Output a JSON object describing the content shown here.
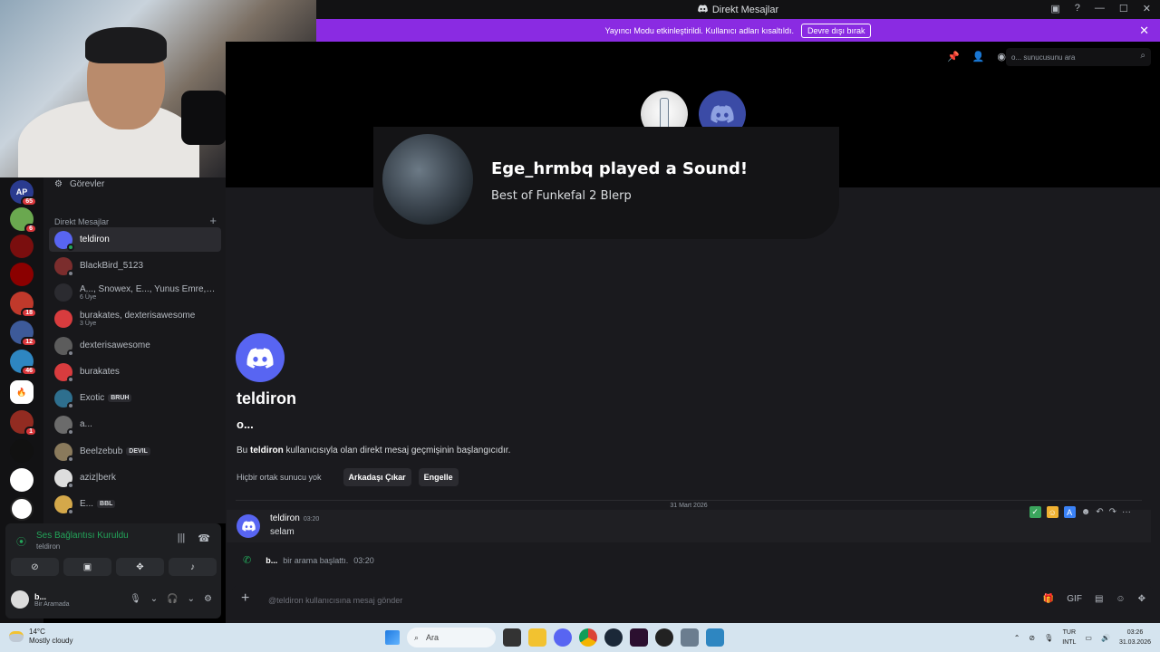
{
  "window": {
    "title": "Direkt Mesajlar"
  },
  "banner": {
    "text": "Yayıncı Modu etkinleştirildi. Kullanıcı adları kısaltıldı.",
    "button": "Devre dışı bırak"
  },
  "topbar": {
    "search_placeholder": "o... sunucusunu ara"
  },
  "sidebar": {
    "tasks_label": "Görevler",
    "dm_header": "Direkt Mesajlar",
    "dms": [
      {
        "name": "teldiron",
        "sub": "",
        "tag": ""
      },
      {
        "name": "BlackBird_5123",
        "sub": "",
        "tag": ""
      },
      {
        "name": "A..., Snowex, E..., Yunus Emre, b...",
        "sub": "6 Üye",
        "tag": ""
      },
      {
        "name": "burakates, dexterisawesome",
        "sub": "3 Üye",
        "tag": ""
      },
      {
        "name": "dexterisawesome",
        "sub": "",
        "tag": ""
      },
      {
        "name": "burakates",
        "sub": "",
        "tag": ""
      },
      {
        "name": "Exotic",
        "sub": "",
        "tag": "BRUH"
      },
      {
        "name": "a...",
        "sub": "",
        "tag": ""
      },
      {
        "name": "Beelzebub",
        "sub": "",
        "tag": "DEVIL"
      },
      {
        "name": "aziz|berk",
        "sub": "",
        "tag": ""
      },
      {
        "name": "E...",
        "sub": "",
        "tag": "BBL"
      }
    ]
  },
  "servers": [
    {
      "label": "AP",
      "badge": "65"
    },
    {
      "label": "",
      "badge": "6"
    },
    {
      "label": "",
      "badge": ""
    },
    {
      "label": "",
      "badge": ""
    },
    {
      "label": "",
      "badge": "18"
    },
    {
      "label": "",
      "badge": "12"
    },
    {
      "label": "",
      "badge": "46"
    },
    {
      "label": "",
      "badge": ""
    },
    {
      "label": "",
      "badge": "1"
    },
    {
      "label": "",
      "badge": ""
    },
    {
      "label": "",
      "badge": ""
    },
    {
      "label": "",
      "badge": ""
    }
  ],
  "voice": {
    "status": "Ses Bağlantısı Kuruldu",
    "channel": "teldiron",
    "user": "b...",
    "user_status": "Bir Aramada"
  },
  "soundboard": {
    "title": "Ege_hrmbq played a Sound!",
    "sound_name": "Best of Funkefal 2 Blerp"
  },
  "intro": {
    "name": "teldiron",
    "handle": "o...",
    "desc_pre": "Bu ",
    "desc_name": "teldiron",
    "desc_post": " kullanıcısıyla olan direkt mesaj geçmişinin başlangıcıdır.",
    "mutual": "Hiçbir ortak sunucu yok",
    "remove_friend": "Arkadaşı Çıkar",
    "block": "Engelle"
  },
  "date_separator": "31 Mart 2026",
  "message": {
    "author": "teldiron",
    "time": "03:20",
    "text": "selam"
  },
  "call_log": {
    "user": "b...",
    "text": "bir arama başlattı.",
    "time": "03:20"
  },
  "composer": {
    "placeholder": "@teldiron kullanıcısına mesaj gönder"
  },
  "taskbar": {
    "temp": "14°C",
    "weather": "Mostly cloudy",
    "search": "Ara",
    "lang1": "TUR",
    "lang2": "INTL",
    "time": "03:26",
    "date": "31.03.2026"
  },
  "colors": {
    "accent": "#5865f2",
    "online": "#23a55a",
    "danger": "#da373c",
    "banner": "#8a2be2"
  }
}
